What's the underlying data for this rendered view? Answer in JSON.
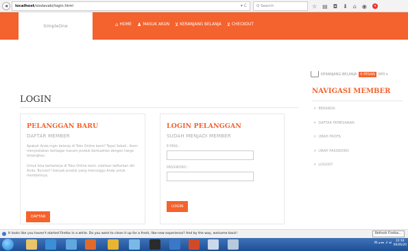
{
  "browser": {
    "url_host": "localhost",
    "url_path": "/sisdavaki/login.html",
    "reload_glyph": "▾ C",
    "search_placeholder": "Q  Search",
    "toolbar_icons": [
      "star-icon",
      "bookmarks-icon",
      "pocket-icon",
      "download-icon",
      "home-icon",
      "chat-icon",
      "addon-icon"
    ]
  },
  "header": {
    "logo_text": "SimpleOne",
    "nav": [
      {
        "icon": "home-icon",
        "label": "HOME"
      },
      {
        "icon": "user-icon",
        "label": "MASUK AKUN"
      },
      {
        "icon": "cart-icon",
        "label": "KERANJANG BELANJA"
      },
      {
        "icon": "cart-icon",
        "label": "CHECKOUT"
      }
    ]
  },
  "cart_summary": {
    "label": "KERANJANG BELANJA",
    "badge": "0 PESAN",
    "currency": "RP0 ▾"
  },
  "page": {
    "title": "LOGIN"
  },
  "new_customer": {
    "heading": "PELANGGAN BARU",
    "subheading": "DAFTAR MEMBER",
    "text1": "Apakah Anda ingin belanja di Toko Online kami? Tepat Sekali.. Kami menyediakan berbagai macam produk berkualitas dengan harga terjangkau.",
    "text2": "Untuk bisa berbelanja di Toko Online kami. silahkan daftarkan diri Anda. Buruan!! banyak produk yang menunggu Anda untuk membelinya.",
    "button": "DAFTAR"
  },
  "login": {
    "heading": "LOGIN PELANGGAN",
    "subheading": "SUDAH MENJADI MEMBER",
    "email_label": "E-MAIL :",
    "email_value": "",
    "password_label": "PASSWORD :",
    "password_value": "",
    "button": "LOGIN"
  },
  "member_nav": {
    "title": "NAVIGASI MEMBER",
    "items": [
      "BERANDA",
      "DAFTAR PEMESANAN",
      "UBAH PROFIL",
      "UBAH PASSWORD",
      "LOGOUT"
    ]
  },
  "notification": {
    "text": "It looks like you haven't started Firefox in a while. Do you want to clean it up for a fresh, like-new experience? And by the way, welcome back!",
    "button": "Refresh Firefox..."
  },
  "taskbar": {
    "tray_text": "IN  ▴  ▸▸  .ıl  ◂)",
    "time": "22:18",
    "date": "09/06/20"
  },
  "colors": {
    "accent": "#f4622d",
    "taskbar": "#2a5ea8"
  }
}
